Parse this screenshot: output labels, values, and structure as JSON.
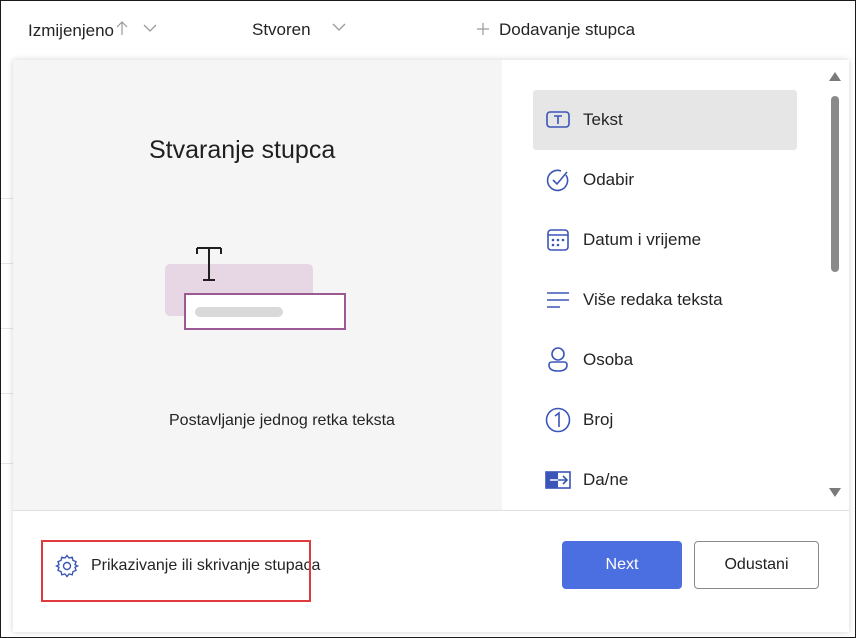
{
  "header": {
    "columns": [
      {
        "label": "Izmijenjeno",
        "sort_icon": "arrow-up-icon",
        "menu_icon": "chevron-down-icon"
      },
      {
        "label": "Stvoren",
        "menu_icon": "chevron-down-icon"
      },
      {
        "label": "Dodavanje stupca",
        "icon": "plus-icon"
      }
    ]
  },
  "dialog": {
    "title": "Stvaranje stupca",
    "preview_caption": "Postavljanje jednog retka teksta",
    "column_types": [
      {
        "label": "Tekst",
        "icon": "text-icon",
        "selected": true
      },
      {
        "label": "Odabir",
        "icon": "checkmark-circle-icon",
        "selected": false
      },
      {
        "label": "Datum i vrijeme",
        "icon": "calendar-icon",
        "selected": false
      },
      {
        "label": "Više redaka teksta",
        "icon": "multiline-text-icon",
        "selected": false
      },
      {
        "label": "Osoba",
        "icon": "person-icon",
        "selected": false
      },
      {
        "label": "Broj",
        "icon": "number-icon",
        "selected": false
      },
      {
        "label": "Da/ne",
        "icon": "yes-no-icon",
        "selected": false
      }
    ],
    "show_hide_label": "Prikazivanje ili skrivanje stupaca",
    "next_label": "Next",
    "cancel_label": "Odustani"
  },
  "colors": {
    "primary_button": "#4b6ee0",
    "highlight_border": "#e0393e",
    "selected_item_bg": "#e6e6e6",
    "illustration_accent": "#9c5a95"
  }
}
